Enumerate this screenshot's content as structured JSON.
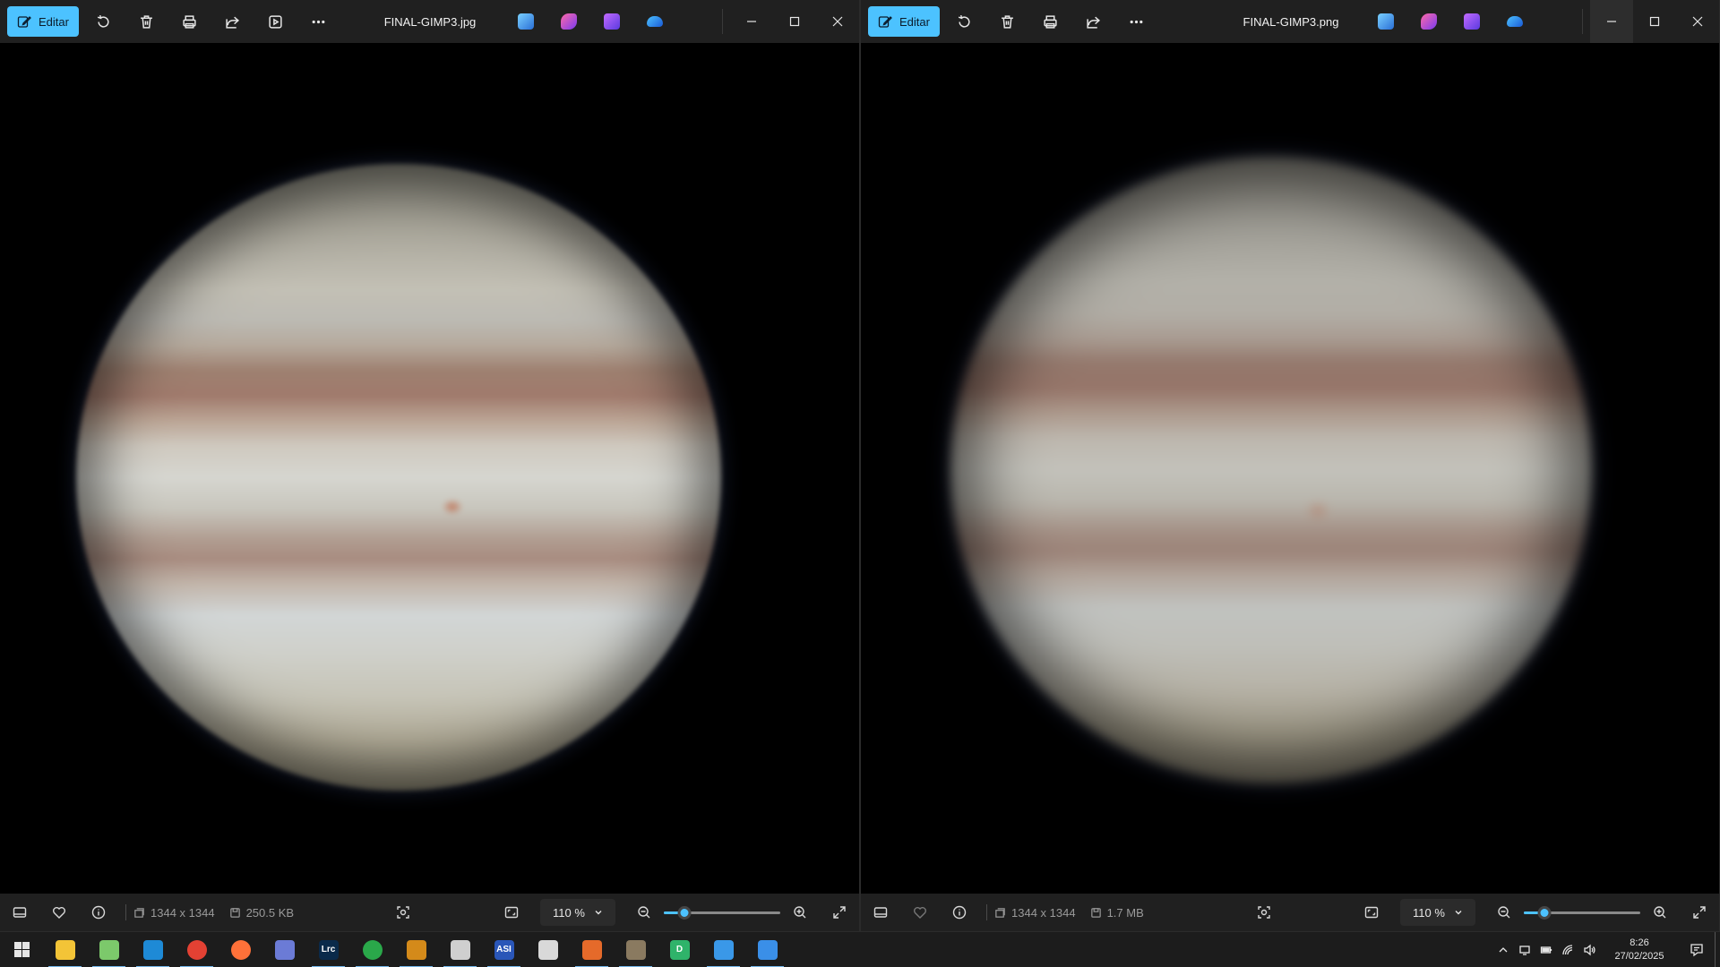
{
  "windows": {
    "left": {
      "edit_label": "Editar",
      "filename": "FINAL-GIMP3.jpg",
      "dimensions": "1344 x 1344",
      "file_size": "250.5 KB",
      "zoom": "110 %",
      "zoom_slider_fraction": 0.18
    },
    "right": {
      "edit_label": "Editar",
      "filename": "FINAL-GIMP3.png",
      "dimensions": "1344 x 1344",
      "file_size": "1.7 MB",
      "zoom": "110 %",
      "zoom_slider_fraction": 0.18
    }
  },
  "toolbar_icons": [
    "rotate-icon",
    "delete-icon",
    "print-icon",
    "share-icon",
    "slideshow-icon",
    "more-icon"
  ],
  "title_app_icons": [
    {
      "name": "photo-editor-app-icon",
      "color": "#3a8fe8"
    },
    {
      "name": "clipchamp-app-icon",
      "color": "#c24ae0"
    },
    {
      "name": "video-app-icon",
      "color": "#8a5cf0"
    },
    {
      "name": "onedrive-app-icon",
      "color": "#2d8fe0"
    }
  ],
  "colors": {
    "accent": "#4cc2ff",
    "titlebar": "#202020",
    "taskbar": "#1c1c1c"
  },
  "taskbar": {
    "apps": [
      {
        "name": "file-explorer-icon",
        "glyph": "",
        "color": "#f3c437"
      },
      {
        "name": "notepad-app-icon",
        "glyph": "",
        "color": "#7cc96b"
      },
      {
        "name": "vscode-app-icon",
        "glyph": "",
        "color": "#1e8ad6"
      },
      {
        "name": "chrome-app-icon",
        "glyph": "",
        "color": "#e34133"
      },
      {
        "name": "firefox-app-icon",
        "glyph": "",
        "color": "#ff7139"
      },
      {
        "name": "network-app-icon",
        "glyph": "",
        "color": "#6b7bd6"
      },
      {
        "name": "lightroom-app-icon",
        "glyph": "Lrc",
        "color": "#0a2a4a"
      },
      {
        "name": "astro-app-icon",
        "glyph": "",
        "color": "#2aa84a"
      },
      {
        "name": "sharpcap-app-icon",
        "glyph": "",
        "color": "#d48a1a"
      },
      {
        "name": "stacker-app-icon",
        "glyph": "",
        "color": "#cfcfcf"
      },
      {
        "name": "asi-app-icon",
        "glyph": "ASI",
        "color": "#2a56b8"
      },
      {
        "name": "paint-app-icon",
        "glyph": "",
        "color": "#d9d9d9"
      },
      {
        "name": "astro-editor-app-icon",
        "glyph": "",
        "color": "#e56a2a"
      },
      {
        "name": "gimp-app-icon",
        "glyph": "",
        "color": "#8a7a60"
      },
      {
        "name": "topaz-app-icon",
        "glyph": "D",
        "color": "#2fb36a"
      },
      {
        "name": "remote-desktop-app-icon",
        "glyph": "",
        "color": "#3a98e8"
      },
      {
        "name": "photos-app-icon",
        "glyph": "",
        "color": "#3a8fe8"
      }
    ],
    "clock_time": "8:26",
    "clock_date": "27/02/2025"
  }
}
